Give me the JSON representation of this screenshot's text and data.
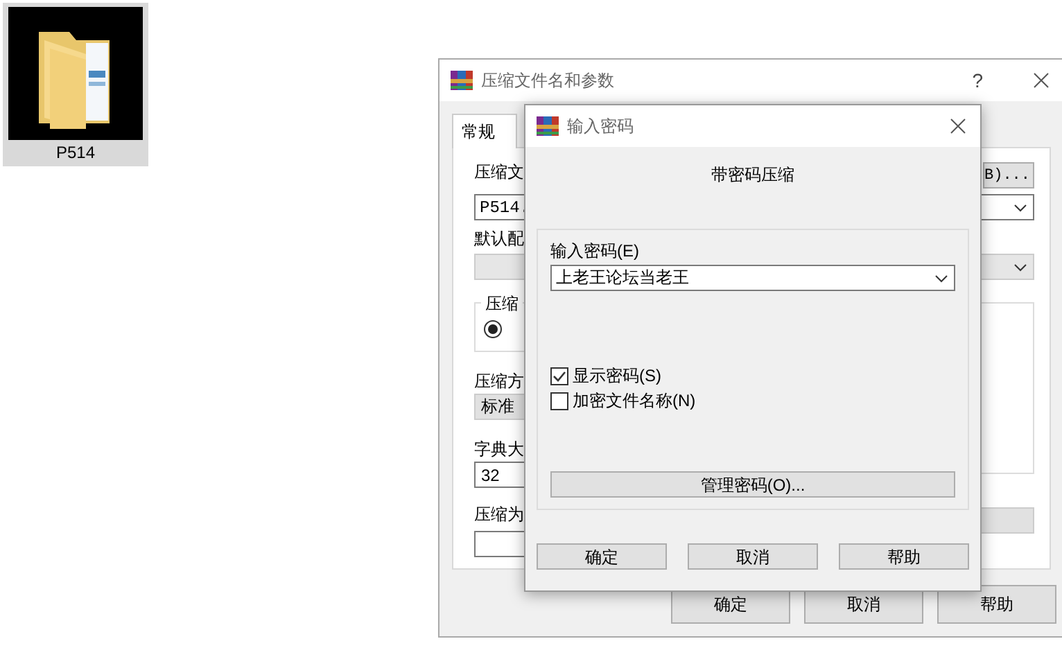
{
  "desktop_icon": {
    "label": "P514",
    "selected": true
  },
  "main_window": {
    "title": "压缩文件名和参数",
    "help_button": "?",
    "tabs": [
      {
        "label": "常规",
        "selected": true
      }
    ],
    "archive_name_label": "压缩文",
    "browse_button": "B)...",
    "archive_name": "P514.",
    "profile_label": "默认配",
    "format_group": {
      "title": "压缩",
      "options": [
        {
          "selected": true
        }
      ]
    },
    "method_label": "压缩方",
    "method": "标准",
    "dictionary_label": "字典大",
    "dictionary": "32",
    "split_label": "压缩为",
    "buttons": [
      "确定",
      "取消",
      "帮助"
    ]
  },
  "password_dialog": {
    "title": "输入密码",
    "heading": "带密码压缩",
    "password_label": "输入密码(E)",
    "password": "上老王论坛当老王",
    "options": [
      {
        "label": "显示密码(S)",
        "checked": true
      },
      {
        "label": "加密文件名称(N)",
        "checked": false
      }
    ],
    "manage_button": "管理密码(O)...",
    "buttons": [
      "确定",
      "取消",
      "帮助"
    ]
  }
}
